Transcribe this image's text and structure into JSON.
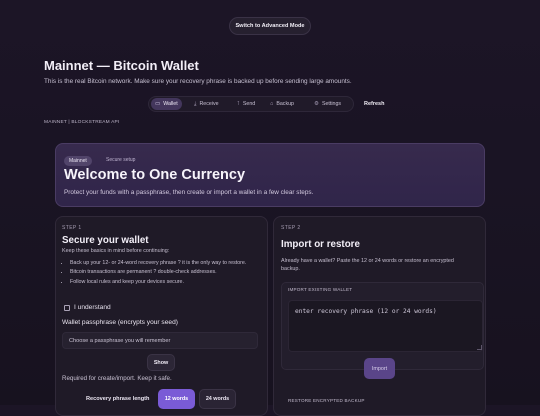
{
  "top": {
    "advanced_button": "Switch to Advanced Mode"
  },
  "header": {
    "title": "Mainnet — Bitcoin Wallet",
    "subtitle": "This is the real Bitcoin network. Make sure your recovery phrase is backed up before sending large amounts."
  },
  "nav": {
    "tabs": [
      {
        "label": "Wallet",
        "icon": "wallet-icon",
        "active": true
      },
      {
        "label": "Receive",
        "icon": "download-icon",
        "active": false
      },
      {
        "label": "Send",
        "icon": "send-icon",
        "active": false
      },
      {
        "label": "Backup",
        "icon": "backup-icon",
        "active": false
      },
      {
        "label": "Settings",
        "icon": "gear-icon",
        "active": false
      }
    ],
    "refresh": "Refresh"
  },
  "network_line": "MAINNET | BLOCKSTREAM API",
  "hero": {
    "pill": "Mainnet",
    "tag": "Secure setup",
    "title": "Welcome to One Currency",
    "subtitle": "Protect your funds with a passphrase, then create or import a wallet in a few clear steps."
  },
  "step1": {
    "step": "STEP 1",
    "title": "Secure your wallet",
    "intro": "Keep these basics in mind before continuing:",
    "bullets": [
      "Back up your 12- or 24-word recovery phrase ? it is the only way to restore.",
      "Bitcoin transactions are permanent ? double-check addresses.",
      "Follow local rules and keep your devices secure."
    ],
    "checkbox_label": "I understand",
    "passphrase_label": "Wallet passphrase (encrypts your seed)",
    "passphrase_placeholder": "Choose a passphrase you will remember",
    "show_button": "Show",
    "required_note": "Required for create/import. Keep it safe.",
    "length_label": "Recovery phrase length",
    "length_options": [
      "12 words",
      "24 words"
    ],
    "length_selected": "12 words"
  },
  "step2": {
    "step": "STEP 2",
    "title": "Import or restore",
    "intro": "Already have a wallet? Paste the 12 or 24 words or restore an encrypted backup.",
    "import_label": "IMPORT EXISTING WALLET",
    "phrase_placeholder": "enter recovery phrase (12 or 24 words)",
    "import_button": "Import",
    "restore_label": "RESTORE ENCRYPTED BACKUP"
  },
  "colors": {
    "accent": "#7a5bd6",
    "hero_bg": "#372a4d",
    "page_bg": "#1a1424"
  }
}
